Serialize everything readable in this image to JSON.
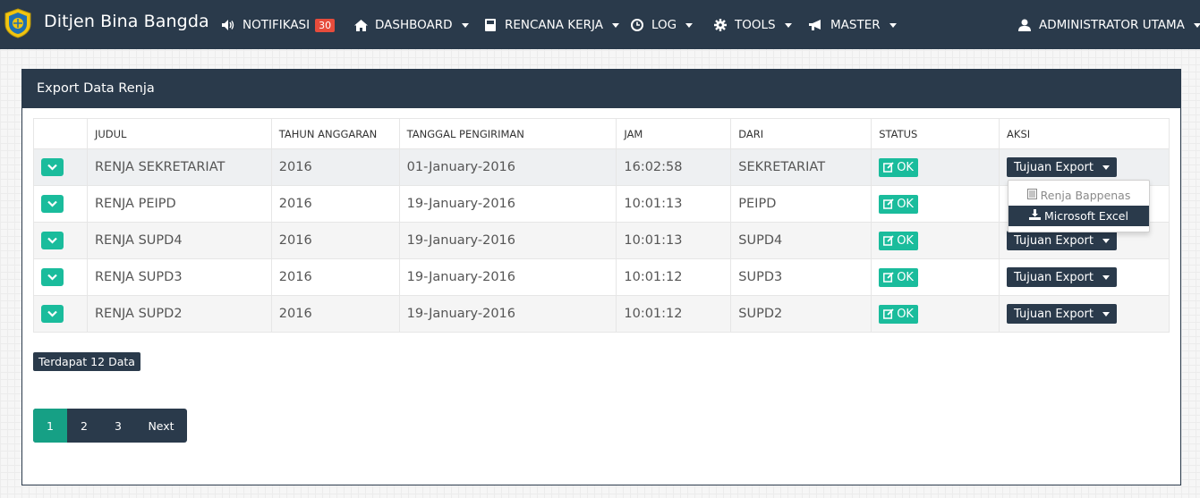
{
  "navbar": {
    "brand": "Ditjen Bina Bangda",
    "notifikasi": {
      "label": "NOTIFIKASI",
      "count": "30"
    },
    "menus": [
      {
        "label": "DASHBOARD",
        "icon": "home-icon"
      },
      {
        "label": "RENCANA KERJA",
        "icon": "book-icon"
      },
      {
        "label": "LOG",
        "icon": "clock-icon"
      },
      {
        "label": "TOOLS",
        "icon": "gear-icon"
      },
      {
        "label": "MASTER",
        "icon": "bullhorn-icon"
      }
    ],
    "user": "ADMINISTRATOR UTAMA"
  },
  "panel": {
    "title": "Export Data Renja"
  },
  "table": {
    "headers": [
      "",
      "JUDUL",
      "TAHUN ANGGARAN",
      "TANGGAL PENGIRIMAN",
      "JAM",
      "DARI",
      "STATUS",
      "AKSI"
    ],
    "rows": [
      {
        "judul": "RENJA SEKRETARIAT",
        "tahun": "2016",
        "tanggal": "01-January-2016",
        "jam": "16:02:58",
        "dari": "SEKRETARIAT",
        "status": "OK",
        "aksi": "Tujuan Export"
      },
      {
        "judul": "RENJA PEIPD",
        "tahun": "2016",
        "tanggal": "19-January-2016",
        "jam": "10:01:13",
        "dari": "PEIPD",
        "status": "OK",
        "aksi": "Tujuan Export"
      },
      {
        "judul": "RENJA SUPD4",
        "tahun": "2016",
        "tanggal": "19-January-2016",
        "jam": "10:01:13",
        "dari": "SUPD4",
        "status": "OK",
        "aksi": "Tujuan Export"
      },
      {
        "judul": "RENJA SUPD3",
        "tahun": "2016",
        "tanggal": "19-January-2016",
        "jam": "10:01:12",
        "dari": "SUPD3",
        "status": "OK",
        "aksi": "Tujuan Export"
      },
      {
        "judul": "RENJA SUPD2",
        "tahun": "2016",
        "tanggal": "19-January-2016",
        "jam": "10:01:12",
        "dari": "SUPD2",
        "status": "OK",
        "aksi": "Tujuan Export"
      }
    ]
  },
  "dropdown": {
    "items": [
      {
        "label": "Renja Bappenas",
        "active": false
      },
      {
        "label": "Microsoft Excel",
        "active": true
      }
    ]
  },
  "summary": "Terdapat 12 Data",
  "pagination": {
    "pages": [
      "1",
      "2",
      "3"
    ],
    "active": "1",
    "next": "Next"
  },
  "colors": {
    "navbar": "#2a3a4b",
    "accent": "#1abc9c",
    "badge": "#e74c3c"
  }
}
